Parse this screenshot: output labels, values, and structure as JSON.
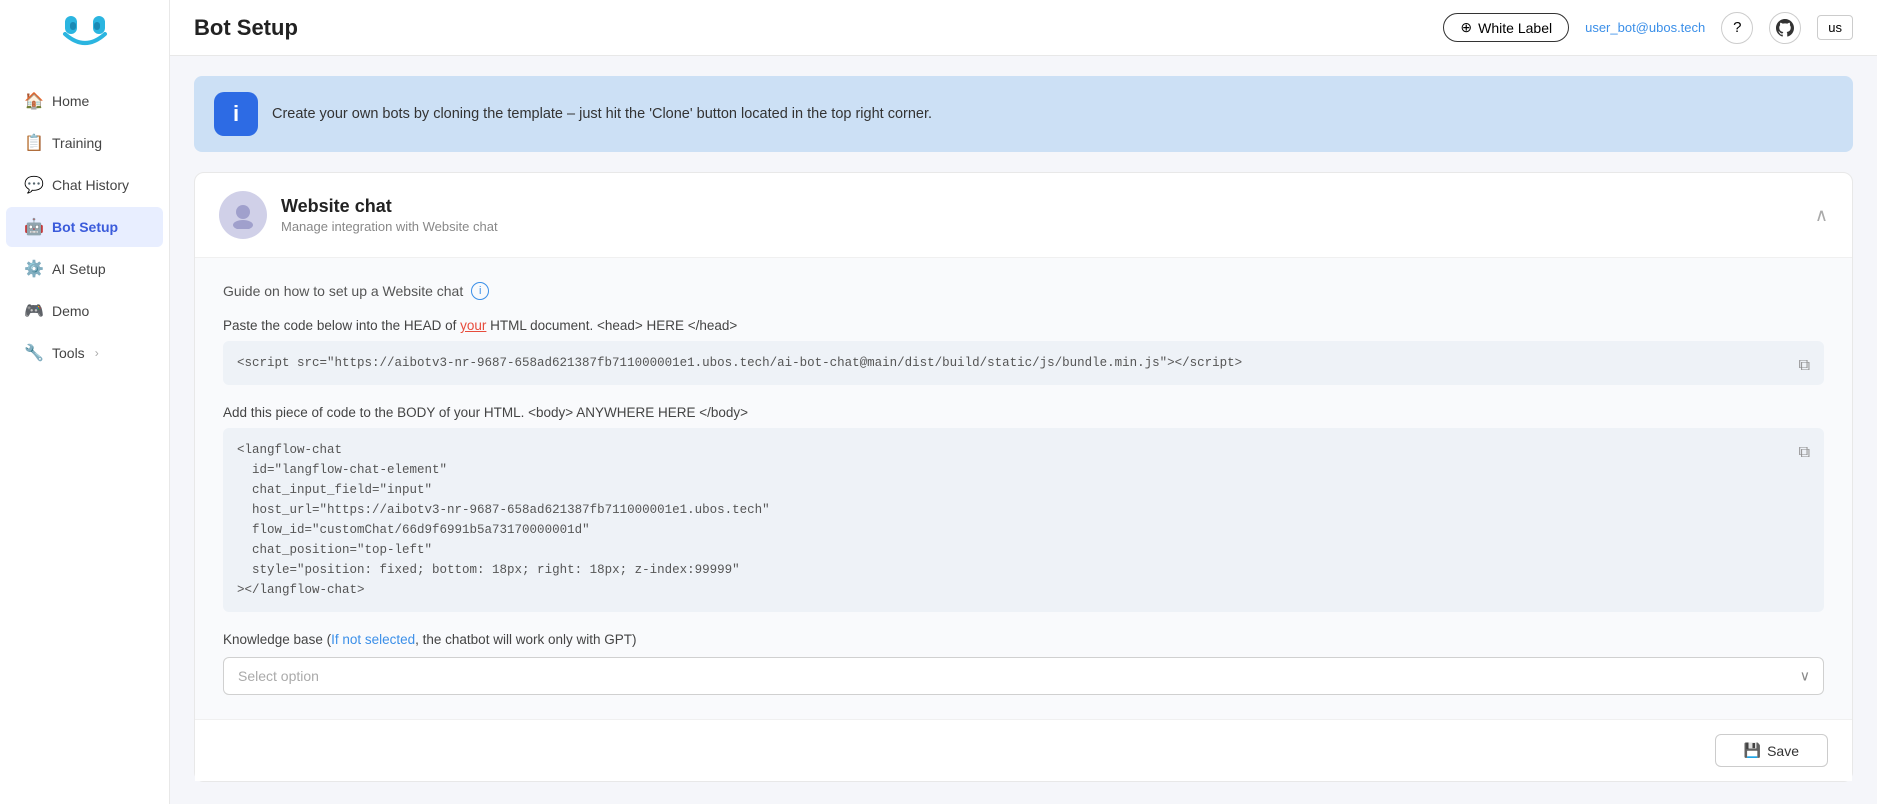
{
  "sidebar": {
    "logo_alt": "UBOS Logo",
    "items": [
      {
        "id": "home",
        "label": "Home",
        "icon": "🏠",
        "active": false
      },
      {
        "id": "training",
        "label": "Training",
        "icon": "📋",
        "active": false
      },
      {
        "id": "chat-history",
        "label": "Chat History",
        "icon": "💬",
        "active": false
      },
      {
        "id": "bot-setup",
        "label": "Bot Setup",
        "icon": "🤖",
        "active": true
      },
      {
        "id": "ai-setup",
        "label": "AI Setup",
        "icon": "⚙️",
        "active": false
      },
      {
        "id": "demo",
        "label": "Demo",
        "icon": "🎮",
        "active": false
      },
      {
        "id": "tools",
        "label": "Tools",
        "icon": "🔧",
        "active": false
      }
    ]
  },
  "header": {
    "title": "Bot Setup",
    "white_label_btn": "White Label",
    "white_label_icon": "⊕",
    "user_email": "user_bot@ubos.tech",
    "help_icon": "?",
    "github_icon": "github",
    "lang_btn": "us"
  },
  "info_banner": {
    "icon": "i",
    "text": "Create your own bots by cloning the template – just hit the 'Clone' button located in the top right corner."
  },
  "website_chat": {
    "title": "Website chat",
    "subtitle": "Manage integration with Website chat",
    "avatar_icon": "💬",
    "guide_link_text": "Guide on how to set up a Website chat",
    "section1_label_prefix": "Paste the code below into the HEAD of ",
    "section1_label_highlight": "your",
    "section1_label_suffix": " HTML document. <head> HERE </head>",
    "code1": "<script src=\"https://aibotv3-nr-9687-658ad621387fb711000001e1.ubos.tech/ai-bot-chat@main/dist/build/static/js/bundle.min.js\"></script>",
    "section2_label_prefix": "Add this piece of code to the BODY of your HTML. <body> ANYWHERE HERE </body>",
    "code2_lines": [
      "<langflow-chat",
      "  id=\"langflow-chat-element\"",
      "  chat_input_field=\"input\"",
      "  host_url=\"https://aibotv3-nr-9687-658ad621387fb711000001e1.ubos.tech\"",
      "  flow_id=\"customChat/66d9f6991b5a73170000001d\"",
      "  chat_position=\"top-left\"",
      "  style=\"position: fixed; bottom: 18px; right: 18px; z-index:99999\"",
      "></langflow-chat>"
    ],
    "knowledge_label_prefix": "Knowledge base (",
    "knowledge_label_link": "If not selected",
    "knowledge_label_suffix": ", the chatbot will work only with GPT)",
    "select_placeholder": "Select option",
    "save_btn_label": "Save",
    "save_icon": "💾"
  }
}
